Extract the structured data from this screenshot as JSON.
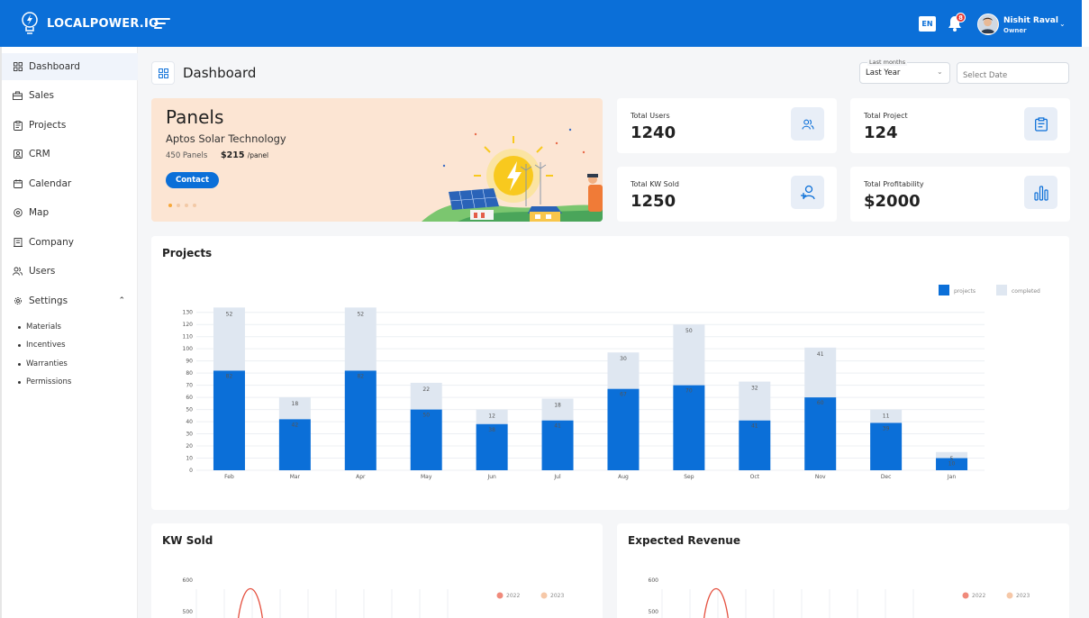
{
  "app": {
    "brand": "LOCALPOWER.IO",
    "lang": "EN",
    "notification_count": "8",
    "user_name": "Nishit Raval",
    "user_role": "Owner",
    "colors": {
      "primary": "#0b6fd8",
      "completed": "#dfe7f1",
      "hero_bg": "#fce5d3"
    }
  },
  "sidebar": {
    "items": [
      {
        "label": "Dashboard",
        "icon": "grid-icon"
      },
      {
        "label": "Sales",
        "icon": "bag-icon"
      },
      {
        "label": "Projects",
        "icon": "clipboard-icon"
      },
      {
        "label": "CRM",
        "icon": "contact-card-icon"
      },
      {
        "label": "Calendar",
        "icon": "calendar-icon"
      },
      {
        "label": "Map",
        "icon": "map-pin-icon"
      },
      {
        "label": "Company",
        "icon": "building-icon"
      },
      {
        "label": "Users",
        "icon": "users-icon"
      },
      {
        "label": "Settings",
        "icon": "gear-icon"
      }
    ],
    "settings_subitems": [
      "Materials",
      "Incentives",
      "Warranties",
      "Permissions"
    ]
  },
  "header": {
    "title": "Dashboard",
    "filter_label": "Last months",
    "filter_value": "Last Year",
    "date_placeholder": "Select Date"
  },
  "hero": {
    "title": "Panels",
    "subtitle": "Aptos Solar Technology",
    "quantity": "450 Panels",
    "price": "$215",
    "price_unit": "/panel",
    "button": "Contact"
  },
  "stats": [
    {
      "label": "Total Users",
      "value": "1240",
      "icon": "users-icon"
    },
    {
      "label": "Total Project",
      "value": "124",
      "icon": "clipboard-icon"
    },
    {
      "label": "Total KW Sold",
      "value": "1250",
      "icon": "user-add-icon"
    },
    {
      "label": "Total Profitability",
      "value": "$2000",
      "icon": "bar-chart-icon"
    }
  ],
  "chart_data": [
    {
      "type": "bar",
      "title": "Projects",
      "stacked": true,
      "categories": [
        "Feb",
        "Mar",
        "Apr",
        "May",
        "Jun",
        "Jul",
        "Aug",
        "Sep",
        "Oct",
        "Nov",
        "Dec",
        "Jan"
      ],
      "series": [
        {
          "name": "projects",
          "color": "#0b6fd8",
          "values": [
            82,
            42,
            82,
            50,
            38,
            41,
            67,
            70,
            41,
            60,
            39,
            10
          ]
        },
        {
          "name": "completed",
          "color": "#dfe7f1",
          "values": [
            52,
            18,
            52,
            22,
            12,
            18,
            30,
            50,
            32,
            41,
            11,
            5
          ]
        }
      ],
      "yticks": [
        0,
        10,
        20,
        30,
        40,
        50,
        60,
        70,
        80,
        90,
        100,
        110,
        120,
        130
      ],
      "ylim": [
        0,
        135
      ],
      "legend": "top-right",
      "grid": true
    },
    {
      "type": "line",
      "title": "KW Sold",
      "series_names": [
        "2022",
        "2023"
      ],
      "series_colors": [
        "#f08a7b",
        "#f6c8a8"
      ],
      "yticks_visible": [
        600,
        500
      ]
    },
    {
      "type": "line",
      "title": "Expected Revenue",
      "series_names": [
        "2022",
        "2023"
      ],
      "series_colors": [
        "#f08a7b",
        "#f6c8a8"
      ],
      "yticks_visible": [
        600,
        500
      ]
    }
  ]
}
